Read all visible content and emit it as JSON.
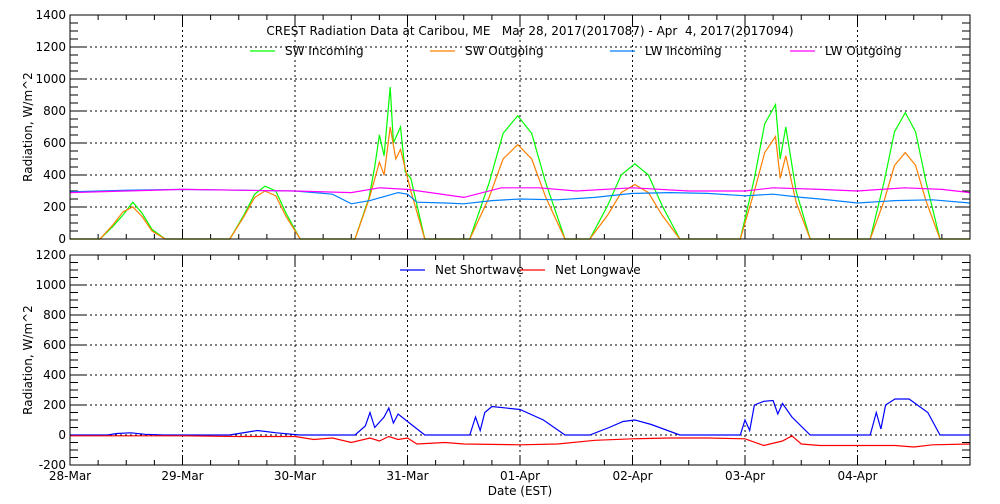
{
  "colors": {
    "sw_in": "#00ff00",
    "sw_out": "#ff7f00",
    "lw_in": "#0080ff",
    "lw_out": "#ff00ff",
    "net_sw": "#0000ff",
    "net_lw": "#ff0000"
  },
  "chart_data": [
    {
      "type": "line",
      "title": "CREST Radiation Data at Caribou, ME   Mar 28, 2017(2017087) - Apr  4, 2017(2017094)",
      "ylabel": "Radiation, W/m^2",
      "xlabel": "",
      "x_unit": "hours since 28-Mar 00:00 EST",
      "xlim": [
        0,
        192
      ],
      "ylim": [
        0,
        1400
      ],
      "yticks": [
        "0",
        "200",
        "400",
        "600",
        "800",
        "1000",
        "1200",
        "1400"
      ],
      "grid": true,
      "legend": "top",
      "series": [
        {
          "name": "SW Incoming",
          "key": "sw_in",
          "points": [
            [
              0,
              0
            ],
            [
              6.4,
              0
            ],
            [
              9.2,
              80
            ],
            [
              11.3,
              150
            ],
            [
              13.4,
              230
            ],
            [
              15.4,
              160
            ],
            [
              17.5,
              60
            ],
            [
              20.3,
              0
            ],
            [
              34.1,
              0
            ],
            [
              37.1,
              150
            ],
            [
              39.4,
              280
            ],
            [
              41.6,
              330
            ],
            [
              43.9,
              300
            ],
            [
              46.1,
              160
            ],
            [
              49.1,
              0
            ],
            [
              60.8,
              0
            ],
            [
              63.8,
              260
            ],
            [
              65,
              450
            ],
            [
              66,
              650
            ],
            [
              67,
              520
            ],
            [
              68.3,
              950
            ],
            [
              69,
              600
            ],
            [
              70.5,
              700
            ],
            [
              71.5,
              420
            ],
            [
              72.7,
              380
            ],
            [
              75.7,
              0
            ],
            [
              85.3,
              0
            ],
            [
              89.4,
              350
            ],
            [
              92.4,
              660
            ],
            [
              95.5,
              770
            ],
            [
              98.5,
              660
            ],
            [
              101.5,
              350
            ],
            [
              105.6,
              0
            ],
            [
              110.9,
              0
            ],
            [
              114.7,
              210
            ],
            [
              117.6,
              400
            ],
            [
              120.5,
              470
            ],
            [
              123.4,
              400
            ],
            [
              126.3,
              210
            ],
            [
              130.1,
              0
            ],
            [
              143,
              0
            ],
            [
              146,
              380
            ],
            [
              148.2,
              720
            ],
            [
              150.5,
              840
            ],
            [
              151.5,
              500
            ],
            [
              152.7,
              700
            ],
            [
              154.9,
              300
            ],
            [
              157.9,
              0
            ],
            [
              170.7,
              0
            ],
            [
              173.7,
              360
            ],
            [
              175.9,
              670
            ],
            [
              178.2,
              790
            ],
            [
              180.4,
              670
            ],
            [
              182.6,
              360
            ],
            [
              185.6,
              0
            ],
            [
              192,
              0
            ]
          ]
        },
        {
          "name": "SW Outgoing",
          "key": "sw_out",
          "points": [
            [
              0,
              0
            ],
            [
              6.4,
              0
            ],
            [
              9.2,
              90
            ],
            [
              11.3,
              170
            ],
            [
              13.4,
              200
            ],
            [
              15.4,
              140
            ],
            [
              17.5,
              50
            ],
            [
              20.3,
              0
            ],
            [
              34.1,
              0
            ],
            [
              37.1,
              140
            ],
            [
              39.4,
              260
            ],
            [
              41.6,
              300
            ],
            [
              43.9,
              270
            ],
            [
              46.1,
              140
            ],
            [
              49.1,
              0
            ],
            [
              60.8,
              0
            ],
            [
              63.8,
              250
            ],
            [
              66,
              480
            ],
            [
              67,
              400
            ],
            [
              68.3,
              700
            ],
            [
              69.5,
              500
            ],
            [
              70.5,
              560
            ],
            [
              72.7,
              300
            ],
            [
              75.7,
              0
            ],
            [
              85.3,
              0
            ],
            [
              89.4,
              260
            ],
            [
              92.4,
              500
            ],
            [
              95.5,
              590
            ],
            [
              98.5,
              500
            ],
            [
              101.5,
              260
            ],
            [
              105.6,
              0
            ],
            [
              110.9,
              0
            ],
            [
              114.7,
              150
            ],
            [
              117.6,
              290
            ],
            [
              120.5,
              340
            ],
            [
              123.4,
              290
            ],
            [
              126.3,
              150
            ],
            [
              130.1,
              0
            ],
            [
              143,
              0
            ],
            [
              146,
              300
            ],
            [
              148.2,
              540
            ],
            [
              150.5,
              640
            ],
            [
              151.5,
              380
            ],
            [
              152.7,
              520
            ],
            [
              154.9,
              230
            ],
            [
              157.9,
              0
            ],
            [
              170.7,
              0
            ],
            [
              173.7,
              240
            ],
            [
              175.9,
              460
            ],
            [
              178.2,
              540
            ],
            [
              180.4,
              460
            ],
            [
              182.6,
              240
            ],
            [
              185.6,
              0
            ],
            [
              192,
              0
            ]
          ]
        },
        {
          "name": "LW Incoming",
          "key": "lw_in",
          "points": [
            [
              0,
              295
            ],
            [
              12,
              305
            ],
            [
              24,
              310
            ],
            [
              36,
              305
            ],
            [
              48,
              300
            ],
            [
              56,
              280
            ],
            [
              60,
              220
            ],
            [
              64,
              240
            ],
            [
              70,
              290
            ],
            [
              72,
              280
            ],
            [
              74,
              230
            ],
            [
              80,
              225
            ],
            [
              84,
              220
            ],
            [
              90,
              240
            ],
            [
              96,
              250
            ],
            [
              104,
              245
            ],
            [
              112,
              260
            ],
            [
              120,
              285
            ],
            [
              128,
              290
            ],
            [
              136,
              285
            ],
            [
              144,
              270
            ],
            [
              150,
              280
            ],
            [
              156,
              260
            ],
            [
              160,
              250
            ],
            [
              168,
              225
            ],
            [
              176,
              240
            ],
            [
              184,
              245
            ],
            [
              192,
              225
            ]
          ]
        },
        {
          "name": "LW Outgoing",
          "key": "lw_out",
          "points": [
            [
              0,
              290
            ],
            [
              12,
              300
            ],
            [
              24,
              310
            ],
            [
              36,
              305
            ],
            [
              48,
              300
            ],
            [
              60,
              290
            ],
            [
              66,
              320
            ],
            [
              72,
              310
            ],
            [
              84,
              260
            ],
            [
              92,
              320
            ],
            [
              100,
              320
            ],
            [
              108,
              300
            ],
            [
              120,
              320
            ],
            [
              132,
              300
            ],
            [
              144,
              300
            ],
            [
              150,
              320
            ],
            [
              160,
              310
            ],
            [
              168,
              300
            ],
            [
              178,
              320
            ],
            [
              186,
              310
            ],
            [
              192,
              290
            ]
          ]
        }
      ]
    },
    {
      "type": "line",
      "xlabel": "Date (EST)",
      "ylabel": "Radiation, W/m^2",
      "x_unit": "hours since 28-Mar 00:00 EST",
      "xlim": [
        0,
        192
      ],
      "ylim": [
        -200,
        1200
      ],
      "yticks": [
        "-200",
        "0",
        "200",
        "400",
        "600",
        "800",
        "1000",
        "1200"
      ],
      "xticks": [
        "28-Mar",
        "29-Mar",
        "30-Mar",
        "31-Mar",
        "01-Apr",
        "02-Apr",
        "03-Apr",
        "04-Apr"
      ],
      "grid": true,
      "legend": "top",
      "series": [
        {
          "name": "Net Shortwave",
          "key": "net_sw",
          "points": [
            [
              0,
              0
            ],
            [
              8,
              0
            ],
            [
              10,
              10
            ],
            [
              13,
              15
            ],
            [
              16,
              5
            ],
            [
              20,
              0
            ],
            [
              34,
              0
            ],
            [
              38,
              20
            ],
            [
              40,
              30
            ],
            [
              44,
              15
            ],
            [
              49,
              0
            ],
            [
              60.8,
              0
            ],
            [
              63,
              60
            ],
            [
              64,
              150
            ],
            [
              65,
              50
            ],
            [
              67,
              120
            ],
            [
              68,
              180
            ],
            [
              69,
              80
            ],
            [
              70,
              140
            ],
            [
              72,
              90
            ],
            [
              75.7,
              0
            ],
            [
              85.3,
              0
            ],
            [
              86.5,
              120
            ],
            [
              87.5,
              30
            ],
            [
              88.5,
              150
            ],
            [
              90,
              190
            ],
            [
              96,
              170
            ],
            [
              101,
              100
            ],
            [
              105.6,
              0
            ],
            [
              110.9,
              0
            ],
            [
              115,
              50
            ],
            [
              118,
              90
            ],
            [
              120.5,
              100
            ],
            [
              124,
              70
            ],
            [
              130.1,
              0
            ],
            [
              143,
              0
            ],
            [
              144,
              100
            ],
            [
              145,
              30
            ],
            [
              146,
              200
            ],
            [
              148,
              225
            ],
            [
              150,
              230
            ],
            [
              151,
              140
            ],
            [
              152,
              210
            ],
            [
              154,
              120
            ],
            [
              157.9,
              0
            ],
            [
              170.7,
              0
            ],
            [
              172,
              150
            ],
            [
              173,
              40
            ],
            [
              174,
              200
            ],
            [
              176,
              240
            ],
            [
              179,
              240
            ],
            [
              183,
              150
            ],
            [
              185.6,
              0
            ],
            [
              192,
              0
            ]
          ]
        },
        {
          "name": "Net Longwave",
          "key": "net_lw",
          "points": [
            [
              0,
              -5
            ],
            [
              24,
              -5
            ],
            [
              36,
              -10
            ],
            [
              48,
              -10
            ],
            [
              52,
              -30
            ],
            [
              56,
              -20
            ],
            [
              60,
              -50
            ],
            [
              64,
              -20
            ],
            [
              66,
              -40
            ],
            [
              68,
              -10
            ],
            [
              70,
              -30
            ],
            [
              72,
              -20
            ],
            [
              74,
              -60
            ],
            [
              80,
              -50
            ],
            [
              84,
              -60
            ],
            [
              96,
              -65
            ],
            [
              104,
              -60
            ],
            [
              112,
              -35
            ],
            [
              120,
              -25
            ],
            [
              128,
              -20
            ],
            [
              136,
              -20
            ],
            [
              144,
              -25
            ],
            [
              148,
              -70
            ],
            [
              152,
              -40
            ],
            [
              154,
              -5
            ],
            [
              156,
              -60
            ],
            [
              160,
              -70
            ],
            [
              168,
              -70
            ],
            [
              176,
              -70
            ],
            [
              180,
              -80
            ],
            [
              184,
              -65
            ],
            [
              192,
              -60
            ]
          ]
        }
      ]
    }
  ]
}
